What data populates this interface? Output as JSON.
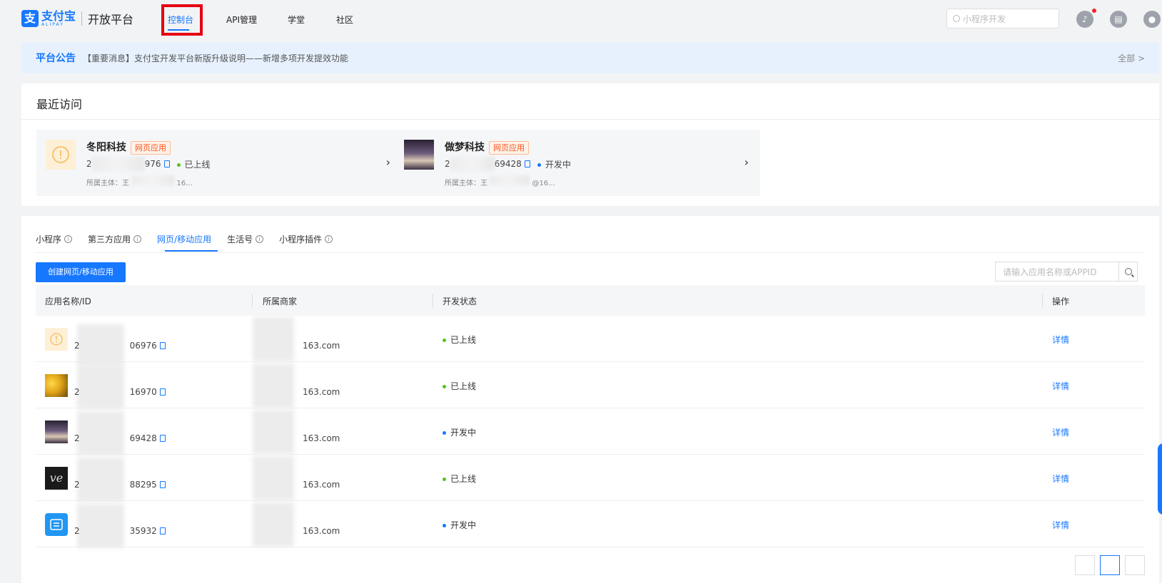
{
  "header": {
    "logo_cn": "支付宝",
    "logo_en": "ALIPAY",
    "platform": "开放平台",
    "nav": [
      {
        "label": "控制台"
      },
      {
        "label": "API管理"
      },
      {
        "label": "学堂"
      },
      {
        "label": "社区"
      }
    ],
    "search_placeholder": "小程序开发"
  },
  "announcement": {
    "label": "平台公告",
    "message": "【重要消息】支付宝开发平台新版升级说明——新增多项开发提效功能",
    "all_link": "全部 >"
  },
  "recent": {
    "title": "最近访问",
    "items": [
      {
        "name": "冬阳科技",
        "tag": "网页应用",
        "id_prefix": "2",
        "id_suffix": "976",
        "status": "已上线",
        "owner_prefix": "所属主体：王",
        "owner_suffix": "16..."
      },
      {
        "name": "做梦科技",
        "tag": "网页应用",
        "id_prefix": "2",
        "id_suffix": "69428",
        "status": "开发中",
        "owner_prefix": "所属主体：王",
        "owner_suffix": "@16..."
      }
    ]
  },
  "apps": {
    "tabs": [
      {
        "label": "小程序"
      },
      {
        "label": "第三方应用"
      },
      {
        "label": "网页/移动应用"
      },
      {
        "label": "生活号"
      },
      {
        "label": "小程序插件"
      }
    ],
    "create_button": "创建网页/移动应用",
    "search_placeholder": "请输入应用名称或APPID",
    "columns": [
      "应用名称/ID",
      "所属商家",
      "开发状态",
      "操作"
    ],
    "rows": [
      {
        "id_prefix": "2",
        "id_suffix": "06976",
        "mail": "163.com",
        "status": "已上线",
        "op": "详情"
      },
      {
        "id_prefix": "2",
        "id_suffix": "16970",
        "mail": "163.com",
        "status": "已上线",
        "op": "详情"
      },
      {
        "id_prefix": "2",
        "id_suffix": "69428",
        "mail": "163.com",
        "status": "开发中",
        "op": "详情"
      },
      {
        "id_prefix": "2",
        "id_suffix": "88295",
        "mail": "163.com",
        "status": "已上线",
        "op": "详情"
      },
      {
        "id_prefix": "2",
        "id_suffix": "35932",
        "mail": "163.com",
        "status": "开发中",
        "op": "详情"
      }
    ]
  },
  "colors": {
    "brand": "#1677ff",
    "highlight": "#e60012",
    "online": "#52c41a"
  }
}
